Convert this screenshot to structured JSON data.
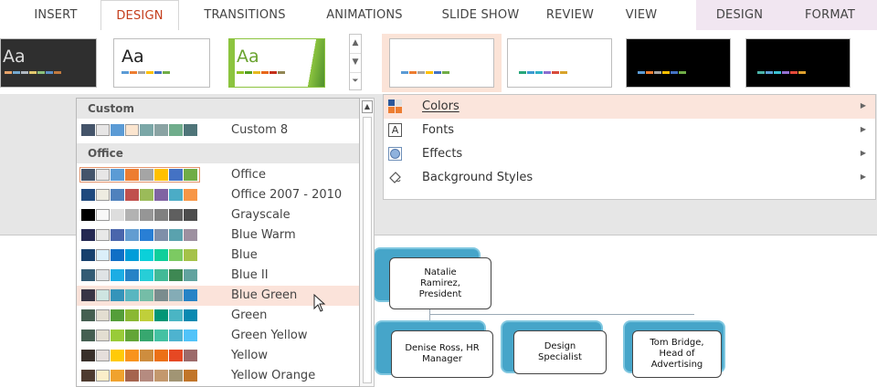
{
  "tabs": [
    {
      "label": "INSERT"
    },
    {
      "label": "DESIGN"
    },
    {
      "label": "TRANSITIONS"
    },
    {
      "label": "ANIMATIONS"
    },
    {
      "label": "SLIDE SHOW"
    },
    {
      "label": "REVIEW"
    },
    {
      "label": "VIEW"
    },
    {
      "label": "DESIGN"
    },
    {
      "label": "FORMAT"
    }
  ],
  "themes": [
    {
      "sample": "Aa"
    },
    {
      "sample": "Aa"
    },
    {
      "sample": "Aa"
    }
  ],
  "menu": {
    "items": [
      {
        "label": "Colors",
        "icon": "colors-icon"
      },
      {
        "label": "Fonts",
        "icon": "fonts-icon"
      },
      {
        "label": "Effects",
        "icon": "effects-icon"
      },
      {
        "label": "Background Styles",
        "icon": "background-styles-icon"
      }
    ]
  },
  "dropdown": {
    "sections": [
      {
        "label": "Custom"
      },
      {
        "label": "Office"
      }
    ],
    "custom": [
      {
        "name": "Custom 8",
        "colors": [
          "#44546a",
          "#e7e6e6",
          "#5b9bd5",
          "#fbe5cf",
          "#7ba7a7",
          "#8aa3a3",
          "#70ad8c",
          "#4f7579"
        ]
      }
    ],
    "schemes": [
      {
        "name": "Office",
        "colors": [
          "#44546a",
          "#e7e6e6",
          "#5b9bd5",
          "#ed7d31",
          "#a5a5a5",
          "#ffc000",
          "#4472c4",
          "#70ad47"
        ]
      },
      {
        "name": "Office 2007 - 2010",
        "colors": [
          "#1f497d",
          "#eeece1",
          "#4f81bd",
          "#c0504d",
          "#9bbb59",
          "#8064a2",
          "#4bacc6",
          "#f79646"
        ]
      },
      {
        "name": "Grayscale",
        "colors": [
          "#000000",
          "#f8f8f8",
          "#dddddd",
          "#b2b2b2",
          "#969696",
          "#808080",
          "#5f5f5f",
          "#4d4d4d"
        ]
      },
      {
        "name": "Blue Warm",
        "colors": [
          "#242852",
          "#e8e8e8",
          "#4a66ac",
          "#629dd1",
          "#297fd5",
          "#7f8fa9",
          "#5aa2ae",
          "#9d90a0"
        ]
      },
      {
        "name": "Blue",
        "colors": [
          "#17406d",
          "#dbeff9",
          "#0f6fc6",
          "#009dd9",
          "#0bd0d9",
          "#10cf9b",
          "#7cca62",
          "#a5c249"
        ]
      },
      {
        "name": "Blue II",
        "colors": [
          "#335b74",
          "#dfe3e5",
          "#1cade4",
          "#2683c6",
          "#27ced7",
          "#42ba97",
          "#3e8853",
          "#62a39f"
        ]
      },
      {
        "name": "Blue Green",
        "colors": [
          "#373545",
          "#cee5e1",
          "#3494ba",
          "#58b6c0",
          "#75bda7",
          "#7a8c8e",
          "#84acb6",
          "#2683c6"
        ]
      },
      {
        "name": "Green",
        "colors": [
          "#455f51",
          "#e3ded1",
          "#549e39",
          "#8ab833",
          "#c0cf3a",
          "#029676",
          "#4ab5c4",
          "#0989b1"
        ]
      },
      {
        "name": "Green Yellow",
        "colors": [
          "#455f51",
          "#e3ded1",
          "#99cb38",
          "#63a537",
          "#37a76f",
          "#44c1a3",
          "#4eb3cf",
          "#51c3f9"
        ]
      },
      {
        "name": "Yellow",
        "colors": [
          "#39302a",
          "#e5dedb",
          "#ffca08",
          "#f8931d",
          "#ce8d3e",
          "#ec7016",
          "#e64823",
          "#9c6a6a"
        ]
      },
      {
        "name": "Yellow Orange",
        "colors": [
          "#4e3b30",
          "#fbeec9",
          "#f0a22e",
          "#a5644e",
          "#b58b80",
          "#c3986d",
          "#a19574",
          "#c17529"
        ]
      }
    ]
  },
  "orgchart": {
    "top": "Natalie Ramirez, President",
    "children": [
      "Denise Ross, HR Manager",
      "Design Specialist",
      "Tom Bridge, Head of Advertising"
    ]
  }
}
